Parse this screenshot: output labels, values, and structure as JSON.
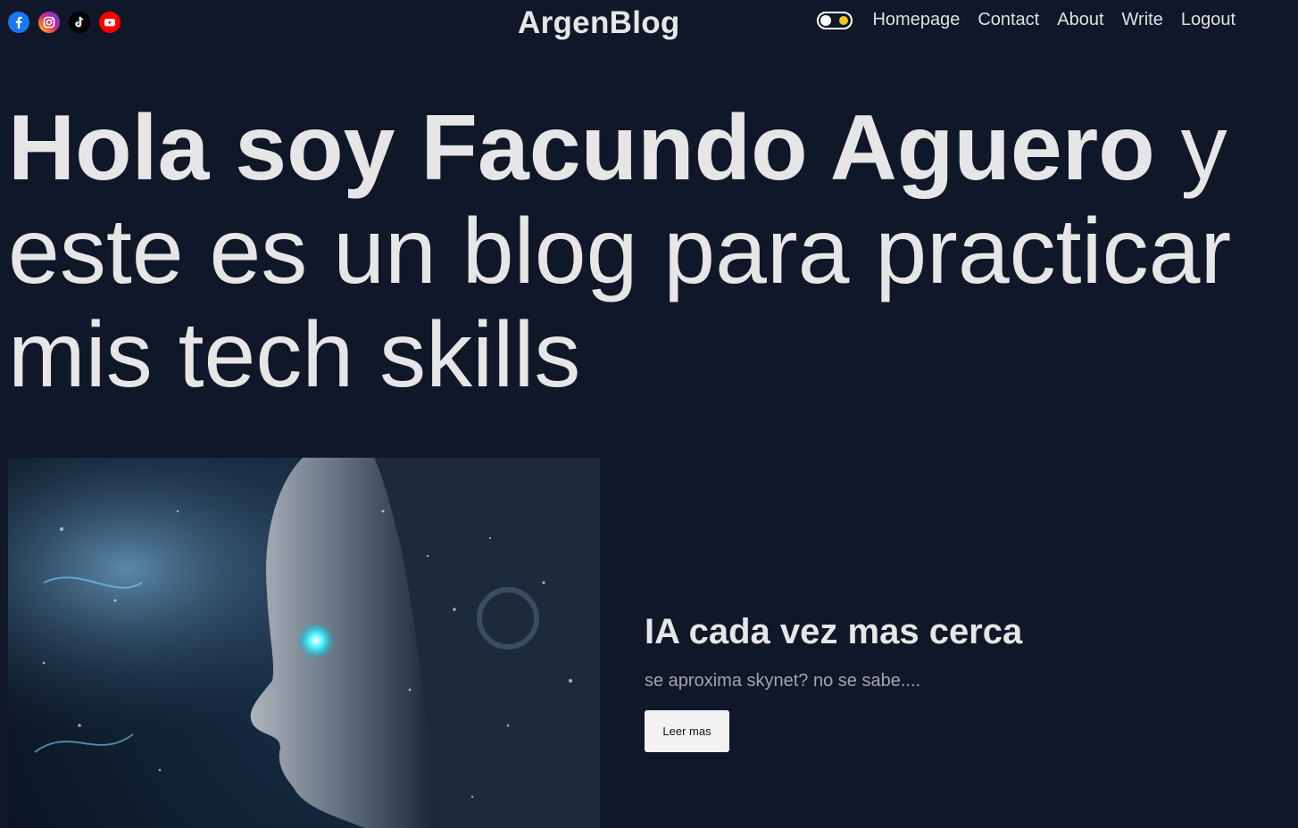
{
  "navbar": {
    "socials": [
      {
        "icon": "facebook-icon",
        "color": "#1877f2"
      },
      {
        "icon": "instagram-icon",
        "color": "#d6249f"
      },
      {
        "icon": "tiktok-icon",
        "color": "#000000"
      },
      {
        "icon": "youtube-icon",
        "color": "#ff0000"
      }
    ],
    "logo": "ArgenBlog",
    "theme_toggle": {
      "state": "dark",
      "icon": "sun-icon",
      "accent": "#f5c518"
    },
    "links": {
      "homepage": "Homepage",
      "contact": "Contact",
      "about": "About",
      "write": "Write",
      "logout": "Logout"
    }
  },
  "hero": {
    "bold": "Hola soy Facundo Aguero",
    "rest": " y este es un blog para practicar mis tech skills"
  },
  "featured_post": {
    "title": "IA cada vez mas cerca",
    "description": "se aproxima skynet? no se sabe....",
    "button_label": "Leer mas"
  },
  "colors": {
    "background": "#0f1729",
    "text": "#e6e6e6",
    "muted": "#a6a6a6",
    "button_bg": "#f2f2f2"
  }
}
